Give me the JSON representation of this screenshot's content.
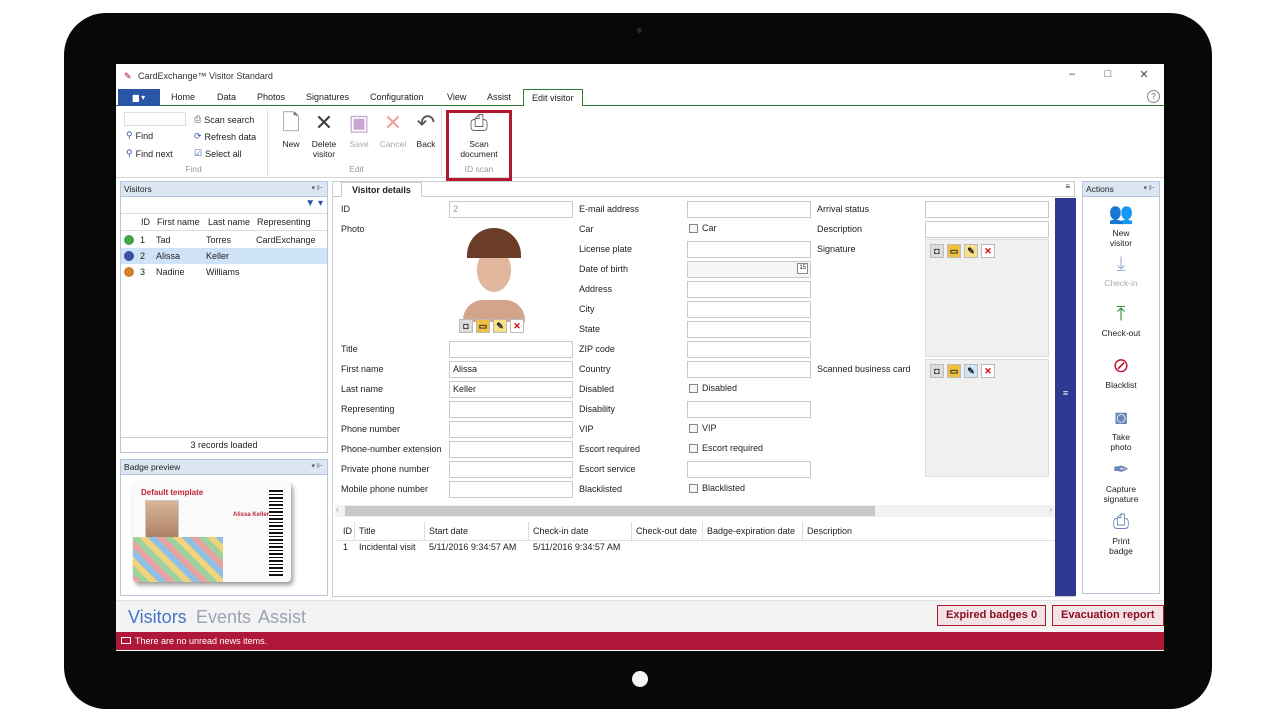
{
  "window": {
    "title": "CardExchange™ Visitor Standard"
  },
  "ribbon": {
    "tabs": [
      "Home",
      "Data",
      "Photos",
      "Signatures",
      "Configuration",
      "View",
      "Assist",
      "Edit visitor"
    ],
    "active_tab": "Edit visitor",
    "find_group": {
      "title": "Find",
      "find": "Find",
      "find_next": "Find next",
      "scan_search": "Scan search",
      "refresh_data": "Refresh data",
      "select_all": "Select all"
    },
    "edit_group": {
      "title": "Edit",
      "new": "New",
      "delete": "Delete\nvisitor",
      "save": "Save",
      "cancel": "Cancel",
      "back": "Back"
    },
    "id_scan_group": {
      "title": "ID scan",
      "scan_document": "Scan\ndocument"
    }
  },
  "visitors_panel": {
    "title": "Visitors",
    "columns": [
      "ID",
      "First name",
      "Last name",
      "Representing"
    ],
    "rows": [
      {
        "id": "1",
        "first": "Tad",
        "last": "Torres",
        "rep": "CardExchange",
        "status_color": "#3fa64a"
      },
      {
        "id": "2",
        "first": "Alissa",
        "last": "Keller",
        "rep": "",
        "status_color": "#3a4fa0"
      },
      {
        "id": "3",
        "first": "Nadine",
        "last": "Williams",
        "rep": "",
        "status_color": "#d08030"
      }
    ],
    "selected_row": 1,
    "record_count": "3 records loaded"
  },
  "badge_panel": {
    "title": "Badge preview",
    "template_name": "Default template",
    "name_on_badge": "Alissa Keller"
  },
  "details": {
    "tab": "Visitor details",
    "col1": {
      "id_label": "ID",
      "id_value": "2",
      "photo_label": "Photo",
      "title_label": "Title",
      "title_value": "",
      "first_label": "First name",
      "first_value": "Alissa",
      "last_label": "Last name",
      "last_value": "Keller",
      "rep_label": "Representing",
      "rep_value": "",
      "phone_label": "Phone number",
      "phone_value": "",
      "ext_label": "Phone-number extension",
      "ext_value": "",
      "private_label": "Private phone number",
      "private_value": "",
      "mobile_label": "Mobile phone number",
      "mobile_value": ""
    },
    "col2": {
      "email": "E-mail address",
      "car": "Car",
      "car_chk": "Car",
      "plate": "License plate",
      "dob": "Date of birth",
      "dob_icon": "15",
      "address": "Address",
      "city": "City",
      "state": "State",
      "zip": "ZIP code",
      "country": "Country",
      "disabled": "Disabled",
      "disabled_chk": "Disabled",
      "disability": "Disability",
      "vip": "VIP",
      "vip_chk": "VIP",
      "escort_req": "Escort required",
      "escort_req_chk": "Escort required",
      "escort_srv": "Escort service",
      "blacklisted": "Blacklisted",
      "blacklisted_chk": "Blacklisted"
    },
    "col3": {
      "arrival": "Arrival status",
      "description": "Description",
      "signature": "Signature",
      "business_card": "Scanned business card"
    },
    "nav_label": "≡"
  },
  "history": {
    "columns": [
      "ID",
      "Title",
      "Start date",
      "Check-in date",
      "Check-out date",
      "Badge-expiration date",
      "Description"
    ],
    "rows": [
      {
        "id": "1",
        "title": "Incidental visit",
        "start": "5/11/2016 9:34:57 AM",
        "checkin": "5/11/2016 9:34:57 AM"
      }
    ]
  },
  "actions": {
    "title": "Actions",
    "items": [
      {
        "label": "New\nvisitor",
        "icon": "people-icon"
      },
      {
        "label": "Check-in",
        "icon": "download-icon"
      },
      {
        "label": "Check-out",
        "icon": "upload-icon"
      },
      {
        "label": "Blacklist",
        "icon": "forbidden-icon"
      },
      {
        "label": "Take\nphoto",
        "icon": "camera-icon"
      },
      {
        "label": "Capture\nsignature",
        "icon": "pen-icon"
      },
      {
        "label": "Print\nbadge",
        "icon": "printer-icon"
      }
    ]
  },
  "bottom": {
    "nav": [
      "Visitors",
      "Events",
      "Assist"
    ],
    "expired": "Expired badges 0",
    "evacuation": "Evacuation report"
  },
  "status": {
    "news": "There are no unread news items."
  },
  "colors": {
    "accent": "#b0183a",
    "brand_blue": "#2b56a8",
    "nav_blue": "#2e3a92"
  }
}
